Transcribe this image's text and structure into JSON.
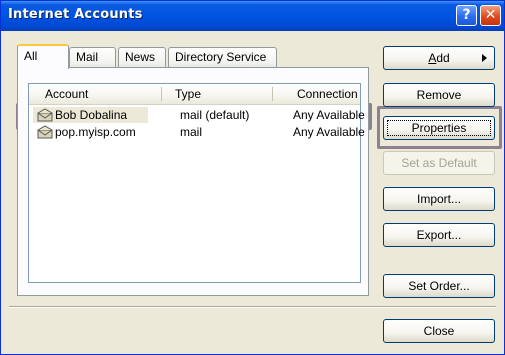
{
  "window": {
    "title": "Internet Accounts",
    "help_glyph": "?",
    "close_glyph": "✕"
  },
  "tabs": [
    {
      "label": "All",
      "active": true
    },
    {
      "label": "Mail",
      "active": false
    },
    {
      "label": "News",
      "active": false
    },
    {
      "label": "Directory Service",
      "active": false
    }
  ],
  "list": {
    "columns": [
      "Account",
      "Type",
      "Connection"
    ],
    "rows": [
      {
        "account": "Bob Dobalina",
        "type": "mail (default)",
        "connection": "Any Available",
        "icon": "mail-account-icon",
        "selected": true
      },
      {
        "account": "pop.myisp.com",
        "type": "mail",
        "connection": "Any Available",
        "icon": "mail-account-icon",
        "selected": false
      }
    ]
  },
  "buttons": {
    "add": {
      "label": "Add",
      "mnemonic": "A",
      "rest": "dd"
    },
    "remove": "Remove",
    "properties": "Properties",
    "set_default": "Set as Default",
    "import": "Import...",
    "export": "Export...",
    "set_order": "Set Order...",
    "close": "Close"
  },
  "colors": {
    "titlebar": "#0054e3",
    "highlight": "#8f8290",
    "face": "#ece9d8"
  }
}
